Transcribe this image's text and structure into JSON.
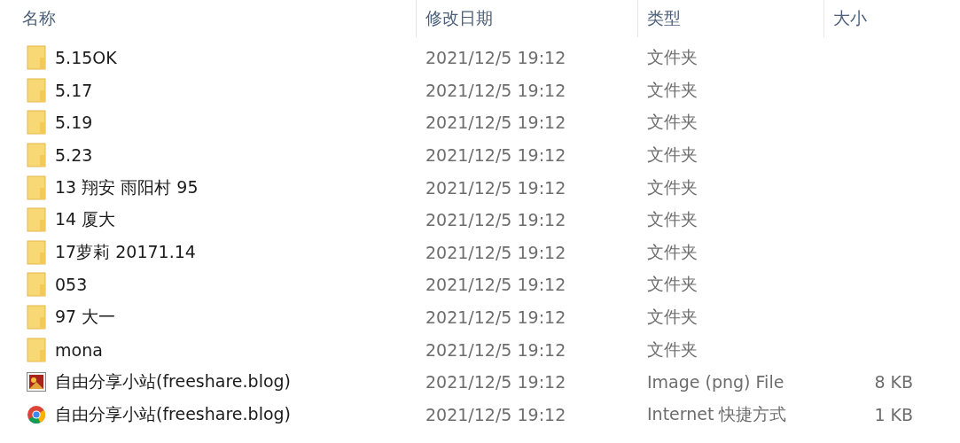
{
  "columns": [
    "名称",
    "修改日期",
    "类型",
    "大小"
  ],
  "rows": [
    {
      "kind": "folder",
      "name": "5.15OK",
      "date": "2021/12/5 19:12",
      "type": "文件夹"
    },
    {
      "kind": "folder",
      "name": "5.17",
      "date": "2021/12/5 19:12",
      "type": "文件夹"
    },
    {
      "kind": "folder",
      "name": "5.19",
      "date": "2021/12/5 19:12",
      "type": "文件夹"
    },
    {
      "kind": "folder",
      "name": "5.23",
      "date": "2021/12/5 19:12",
      "type": "文件夹"
    },
    {
      "kind": "folder",
      "name": "13 翔安 雨阳村 95",
      "date": "2021/12/5 19:12",
      "type": "文件夹"
    },
    {
      "kind": "folder",
      "name": "14 厦大",
      "date": "2021/12/5 19:12",
      "type": "文件夹"
    },
    {
      "kind": "folder",
      "name": "17萝莉 20171.14",
      "date": "2021/12/5 19:12",
      "type": "文件夹"
    },
    {
      "kind": "folder",
      "name": "053",
      "date": "2021/12/5 19:12",
      "type": "文件夹"
    },
    {
      "kind": "folder",
      "name": "97  大一",
      "date": "2021/12/5 19:12",
      "type": "文件夹"
    },
    {
      "kind": "folder",
      "name": "mona",
      "date": "2021/12/5 19:12",
      "type": "文件夹"
    },
    {
      "kind": "image",
      "name": "自由分享小站(freeshare.blog)",
      "date": "2021/12/5 19:12",
      "type": "Image (png) File",
      "size": "8 KB"
    },
    {
      "kind": "shortcut",
      "name": "自由分享小站(freeshare.blog)",
      "date": "2021/12/5 19:12",
      "type": "Internet 快捷方式",
      "size": "1 KB"
    }
  ]
}
